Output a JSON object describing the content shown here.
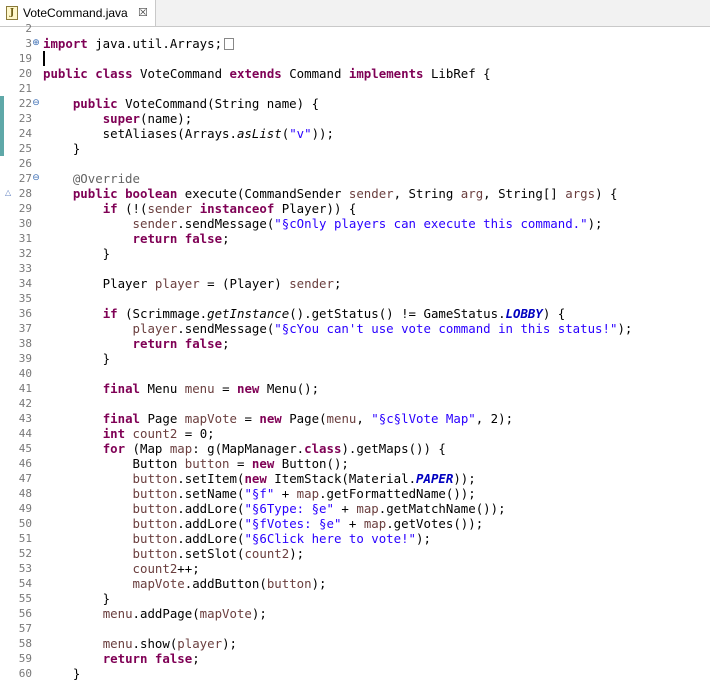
{
  "tab": {
    "title": "VoteCommand.java",
    "close_glyph": "☒"
  },
  "lines": [
    {
      "n": "2",
      "t": []
    },
    {
      "n": "3",
      "fold": "⊕",
      "t": [
        {
          "k": "import"
        },
        " java.util.Arrays;"
      ],
      "folded": true
    },
    {
      "n": "19",
      "cursor": true,
      "t": []
    },
    {
      "n": "20",
      "t": [
        {
          "k": "public"
        },
        " ",
        {
          "k": "class"
        },
        " VoteCommand ",
        {
          "k": "extends"
        },
        " Command ",
        {
          "k": "implements"
        },
        " LibRef {"
      ]
    },
    {
      "n": "21",
      "t": []
    },
    {
      "n": "22",
      "fold": "⊖",
      "mark": true,
      "t": [
        "    ",
        {
          "k": "public"
        },
        " VoteCommand(String name) {"
      ]
    },
    {
      "n": "23",
      "mark": true,
      "t": [
        "        ",
        {
          "k": "super"
        },
        "(name);"
      ]
    },
    {
      "n": "24",
      "mark": true,
      "t": [
        "        setAliases(Arrays.",
        {
          "i": "asList"
        },
        "(",
        {
          "s": "\"v\""
        },
        "));"
      ]
    },
    {
      "n": "25",
      "mark": true,
      "t": [
        "    }"
      ]
    },
    {
      "n": "26",
      "t": []
    },
    {
      "n": "27",
      "fold": "⊖",
      "t": [
        "    ",
        {
          "a": "@Override"
        }
      ]
    },
    {
      "n": "28",
      "override": true,
      "t": [
        "    ",
        {
          "k": "public"
        },
        " ",
        {
          "k": "boolean"
        },
        " execute(CommandSender ",
        {
          "v": "sender"
        },
        ", String ",
        {
          "v": "arg"
        },
        ", String[] ",
        {
          "v": "args"
        },
        ") {"
      ]
    },
    {
      "n": "29",
      "t": [
        "        ",
        {
          "k": "if"
        },
        " (!(",
        {
          "v": "sender"
        },
        " ",
        {
          "k": "instanceof"
        },
        " Player)) {"
      ]
    },
    {
      "n": "30",
      "t": [
        "            ",
        {
          "v": "sender"
        },
        ".sendMessage(",
        {
          "s": "\"§cOnly players can execute this command.\""
        },
        ");"
      ]
    },
    {
      "n": "31",
      "t": [
        "            ",
        {
          "k": "return"
        },
        " ",
        {
          "k": "false"
        },
        ";"
      ]
    },
    {
      "n": "32",
      "t": [
        "        }"
      ]
    },
    {
      "n": "33",
      "t": []
    },
    {
      "n": "34",
      "t": [
        "        Player ",
        {
          "v": "player"
        },
        " = (Player) ",
        {
          "v": "sender"
        },
        ";"
      ]
    },
    {
      "n": "35",
      "t": []
    },
    {
      "n": "36",
      "t": [
        "        ",
        {
          "k": "if"
        },
        " (Scrimmage.",
        {
          "i": "getInstance"
        },
        "().getStatus() != GameStatus.",
        {
          "fi": "LOBBY"
        },
        ") {"
      ]
    },
    {
      "n": "37",
      "t": [
        "            ",
        {
          "v": "player"
        },
        ".sendMessage(",
        {
          "s": "\"§cYou can't use vote command in this status!\""
        },
        ");"
      ]
    },
    {
      "n": "38",
      "t": [
        "            ",
        {
          "k": "return"
        },
        " ",
        {
          "k": "false"
        },
        ";"
      ]
    },
    {
      "n": "39",
      "t": [
        "        }"
      ]
    },
    {
      "n": "40",
      "t": []
    },
    {
      "n": "41",
      "t": [
        "        ",
        {
          "k": "final"
        },
        " Menu ",
        {
          "v": "menu"
        },
        " = ",
        {
          "k": "new"
        },
        " Menu();"
      ]
    },
    {
      "n": "42",
      "t": []
    },
    {
      "n": "43",
      "t": [
        "        ",
        {
          "k": "final"
        },
        " Page ",
        {
          "v": "mapVote"
        },
        " = ",
        {
          "k": "new"
        },
        " Page(",
        {
          "v": "menu"
        },
        ", ",
        {
          "s": "\"§c§lVote Map\""
        },
        ", 2);"
      ]
    },
    {
      "n": "44",
      "t": [
        "        ",
        {
          "k": "int"
        },
        " ",
        {
          "v": "count2"
        },
        " = 0;"
      ]
    },
    {
      "n": "45",
      "t": [
        "        ",
        {
          "k": "for"
        },
        " (Map ",
        {
          "v": "map"
        },
        ": g(MapManager.",
        {
          "k": "class"
        },
        ").getMaps()) {"
      ]
    },
    {
      "n": "46",
      "t": [
        "            Button ",
        {
          "v": "button"
        },
        " = ",
        {
          "k": "new"
        },
        " Button();"
      ]
    },
    {
      "n": "47",
      "t": [
        "            ",
        {
          "v": "button"
        },
        ".setItem(",
        {
          "k": "new"
        },
        " ItemStack(Material.",
        {
          "fi": "PAPER"
        },
        "));"
      ]
    },
    {
      "n": "48",
      "t": [
        "            ",
        {
          "v": "button"
        },
        ".setName(",
        {
          "s": "\"§f\""
        },
        " + ",
        {
          "v": "map"
        },
        ".getFormattedName());"
      ]
    },
    {
      "n": "49",
      "t": [
        "            ",
        {
          "v": "button"
        },
        ".addLore(",
        {
          "s": "\"§6Type: §e\""
        },
        " + ",
        {
          "v": "map"
        },
        ".getMatchName());"
      ]
    },
    {
      "n": "50",
      "t": [
        "            ",
        {
          "v": "button"
        },
        ".addLore(",
        {
          "s": "\"§fVotes: §e\""
        },
        " + ",
        {
          "v": "map"
        },
        ".getVotes());"
      ]
    },
    {
      "n": "51",
      "t": [
        "            ",
        {
          "v": "button"
        },
        ".addLore(",
        {
          "s": "\"§6Click here to vote!\""
        },
        ");"
      ]
    },
    {
      "n": "52",
      "t": [
        "            ",
        {
          "v": "button"
        },
        ".setSlot(",
        {
          "v": "count2"
        },
        ");"
      ]
    },
    {
      "n": "53",
      "t": [
        "            ",
        {
          "v": "count2"
        },
        "++;"
      ]
    },
    {
      "n": "54",
      "t": [
        "            ",
        {
          "v": "mapVote"
        },
        ".addButton(",
        {
          "v": "button"
        },
        ");"
      ]
    },
    {
      "n": "55",
      "t": [
        "        }"
      ]
    },
    {
      "n": "56",
      "t": [
        "        ",
        {
          "v": "menu"
        },
        ".addPage(",
        {
          "v": "mapVote"
        },
        ");"
      ]
    },
    {
      "n": "57",
      "t": []
    },
    {
      "n": "58",
      "t": [
        "        ",
        {
          "v": "menu"
        },
        ".show(",
        {
          "v": "player"
        },
        ");"
      ]
    },
    {
      "n": "59",
      "t": [
        "        ",
        {
          "k": "return"
        },
        " ",
        {
          "k": "false"
        },
        ";"
      ]
    },
    {
      "n": "60",
      "t": [
        "    }"
      ]
    }
  ]
}
